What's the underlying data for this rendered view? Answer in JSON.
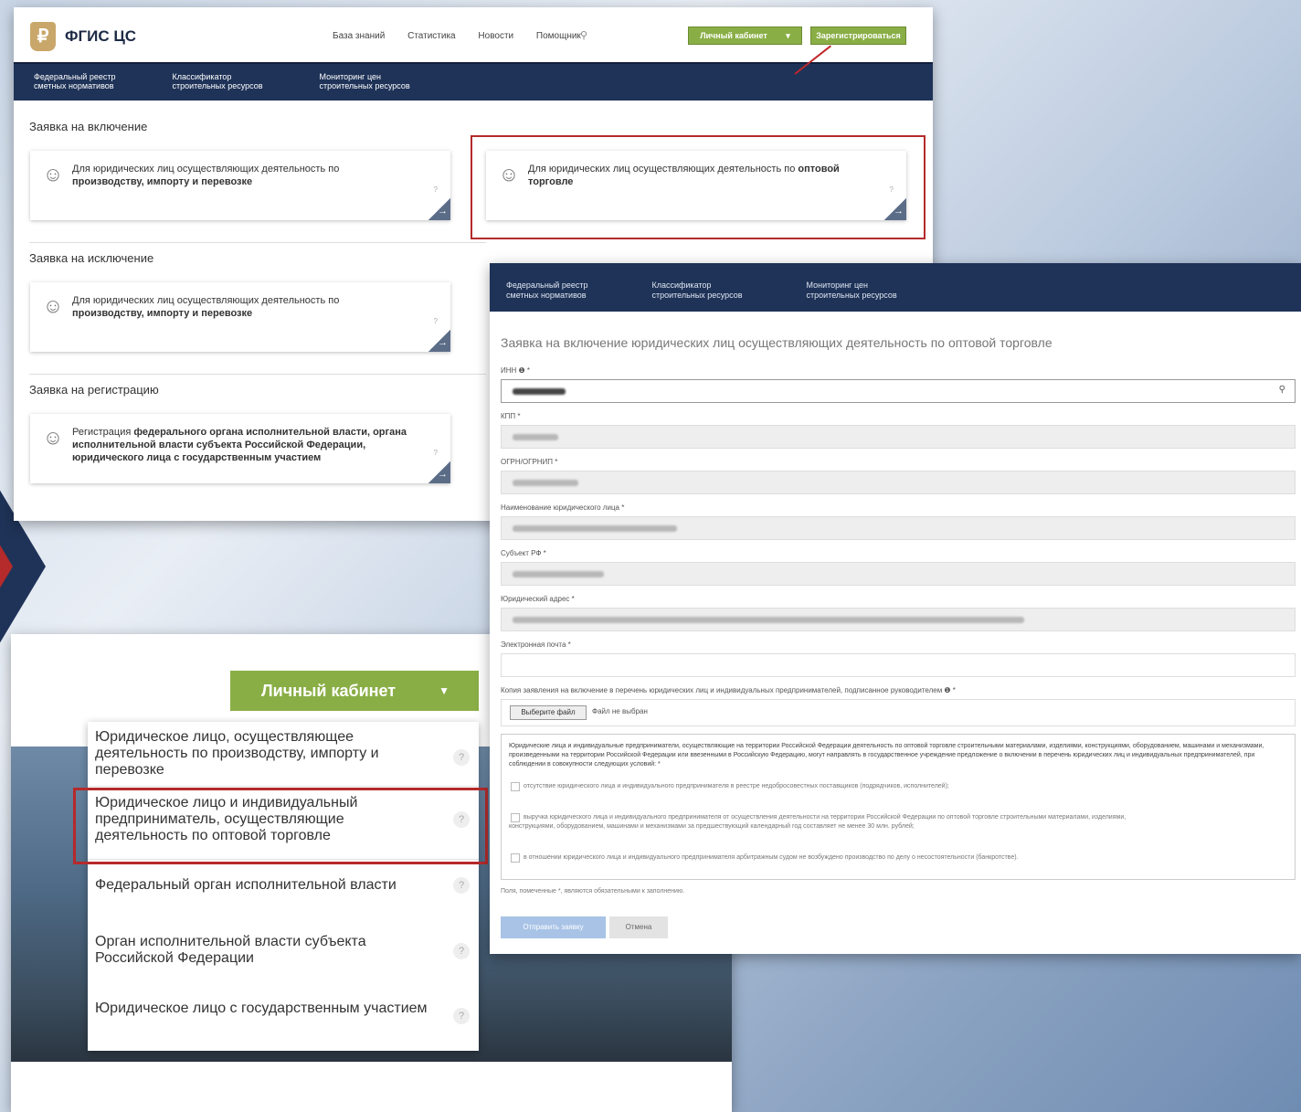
{
  "top_panel": {
    "brand": "ФГИС ЦС",
    "logo_glyph": "₽",
    "nav": [
      "База знаний",
      "Статистика",
      "Новости",
      "Помощник"
    ],
    "btn_cabinet": "Личный кабинет",
    "btn_register": "Зарегистрироваться",
    "menu": [
      {
        "l1": "Федеральный реестр",
        "l2": "сметных нормативов"
      },
      {
        "l1": "Классификатор",
        "l2": "строительных ресурсов"
      },
      {
        "l1": "Мониторинг цен",
        "l2": "строительных ресурсов"
      }
    ],
    "sections": {
      "inclusion": "Заявка на включение",
      "exclusion": "Заявка на исключение",
      "registration": "Заявка на регистрацию"
    },
    "cards": {
      "prod_prefix": "Для юридических лиц осуществляющих деятельность по",
      "prod_bold": "производству, импорту и перевозке",
      "wholesale_prefix": "Для юридических лиц осуществляющих деятельность по",
      "wholesale_bold": "оптовой торговле",
      "reg_prefix": "Регистрация",
      "reg_bold": "федерального органа исполнительной власти, органа исполнительной власти субъекта Российской Федерации, юридического лица с государственным участием"
    }
  },
  "cabinet_panel": {
    "button": "Личный кабинет",
    "items": [
      "Юридическое лицо, осуществляющее деятельность по производству, импорту и перевозке",
      "Юридическое лицо и индивидуальный предприниматель, осуществляющие деятельность по оптовой торговле",
      "Федеральный орган исполнительной власти",
      "Орган исполнительной власти субъекта Российской Федерации",
      "Юридическое лицо с государственным участием"
    ]
  },
  "form_panel": {
    "menu": [
      {
        "l1": "Федеральный реестр",
        "l2": "сметных нормативов"
      },
      {
        "l1": "Классификатор",
        "l2": "строительных ресурсов"
      },
      {
        "l1": "Мониторинг цен",
        "l2": "строительных ресурсов"
      }
    ],
    "title": "Заявка на включение юридических лиц осуществляющих деятельность по оптовой торговле",
    "labels": {
      "inn": "ИНН ❶ *",
      "kpp": "КПП *",
      "ogrn": "ОГРН/ОГРНИП *",
      "name": "Наименование юридического лица *",
      "subject": "Субъект РФ *",
      "address": "Юридический адрес *",
      "email": "Электронная почта *",
      "copy": "Копия заявления на включение в перечень юридических лиц и индивидуальных предпринимателей, подписанное руководителем ❶ *"
    },
    "file_button": "Выберите файл",
    "file_status": "Файл не выбран",
    "conditions_intro": "Юридические лица и индивидуальные предприниматели, осуществляющие на территории Российской Федерации деятельность по оптовой торговле строительными материалами, изделиями, конструкциями, оборудованием, машинами и механизмами, произведенными на территории Российской Федерации или ввезенными в Российскую Федерацию, могут направлять в государственное учреждение предложение о включении в перечень юридических лиц и индивидуальных предпринимателей, при соблюдении в совокупности следующих условий: *",
    "conditions": [
      "отсутствие юридического лица и индивидуального предпринимателя в реестре недобросовестных поставщиков (подрядчиков, исполнителей);",
      "выручка юридического лица и индивидуального предпринимателя от осуществления деятельности на территории Российской Федерации по оптовой торговле строительными материалами, изделиями, конструкциями, оборудованием, машинами и механизмами за предшествующий календарный год составляет не менее 30 млн. рублей;",
      "в отношении юридического лица и индивидуального предпринимателя арбитражным судом не возбуждено производство по делу о несостоятельности (банкротстве)."
    ],
    "required_note": "Поля, помеченные *, являются обязательными к заполнению.",
    "btn_send": "Отправить заявку",
    "btn_cancel": "Отмена"
  }
}
